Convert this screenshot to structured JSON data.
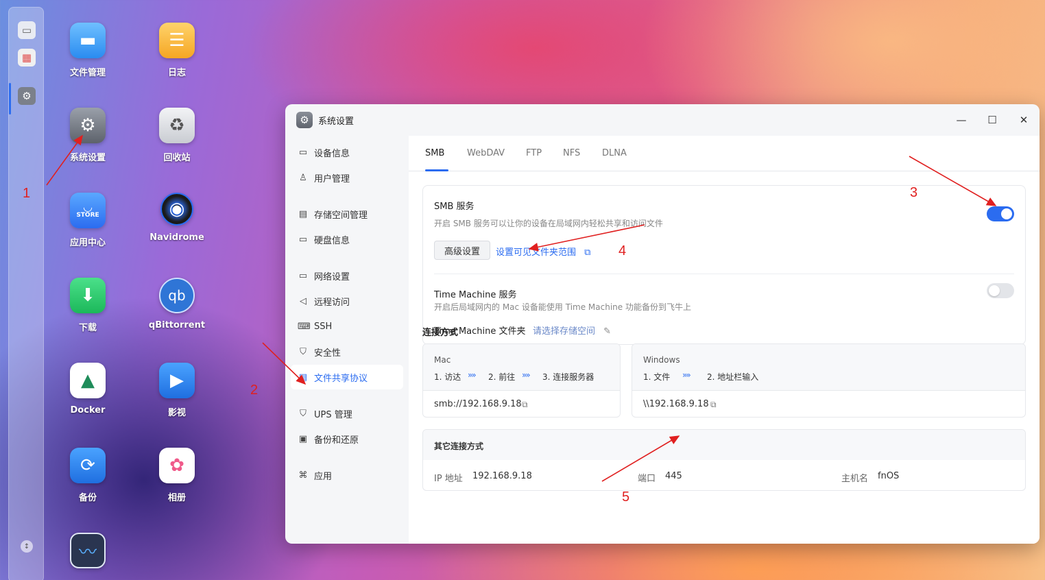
{
  "desktop": {
    "apps": [
      {
        "label": "文件管理",
        "icon": "folder-icon"
      },
      {
        "label": "日志",
        "icon": "log-icon"
      },
      {
        "label": "系统设置",
        "icon": "gear-icon"
      },
      {
        "label": "回收站",
        "icon": "recycle-icon"
      },
      {
        "label": "应用中心",
        "icon": "store-icon",
        "badge": "STORE"
      },
      {
        "label": "Navidrome",
        "icon": "vinyl-icon"
      },
      {
        "label": "下载",
        "icon": "download-icon"
      },
      {
        "label": "qBittorrent",
        "icon": "qb-icon",
        "badge": "qb"
      },
      {
        "label": "Docker",
        "icon": "docker-icon"
      },
      {
        "label": "影视",
        "icon": "video-icon"
      },
      {
        "label": "备份",
        "icon": "backup-icon"
      },
      {
        "label": "相册",
        "icon": "photos-icon"
      },
      {
        "label": "",
        "icon": "monitor-icon"
      }
    ]
  },
  "annotations": [
    "1",
    "2",
    "3",
    "4",
    "5"
  ],
  "window": {
    "title": "系统设置",
    "controls": {
      "minimize": "—",
      "maximize": "☐",
      "close": "✕"
    }
  },
  "sidebar": {
    "items": [
      {
        "label": "设备信息",
        "icon": "device-icon"
      },
      {
        "label": "用户管理",
        "icon": "user-icon"
      },
      {
        "label": "存储空间管理",
        "icon": "storage-icon"
      },
      {
        "label": "硬盘信息",
        "icon": "disk-icon"
      },
      {
        "label": "网络设置",
        "icon": "network-icon"
      },
      {
        "label": "远程访问",
        "icon": "remote-icon"
      },
      {
        "label": "SSH",
        "icon": "ssh-icon"
      },
      {
        "label": "安全性",
        "icon": "shield-icon"
      },
      {
        "label": "文件共享协议",
        "icon": "file-share-icon",
        "active": true
      },
      {
        "label": "UPS 管理",
        "icon": "ups-icon"
      },
      {
        "label": "备份和还原",
        "icon": "backup-restore-icon"
      },
      {
        "label": "应用",
        "icon": "apps-icon"
      }
    ]
  },
  "tabs": [
    {
      "label": "SMB",
      "active": true
    },
    {
      "label": "WebDAV"
    },
    {
      "label": "FTP"
    },
    {
      "label": "NFS"
    },
    {
      "label": "DLNA"
    }
  ],
  "smb": {
    "title": "SMB 服务",
    "desc": "开启 SMB 服务可以让你的设备在局域网内轻松共享和访问文件",
    "enabled": true,
    "advanced_btn": "高级设置",
    "visible_range_link": "设置可见文件夹范围",
    "tm_title": "Time Machine 服务",
    "tm_desc": "开启后局域网内的 Mac 设备能使用 Time Machine 功能备份到飞牛上",
    "tm_enabled": false,
    "tm_folder_label": "Time Machine 文件夹",
    "tm_folder_value": "请选择存储空间"
  },
  "connection": {
    "title": "连接方式",
    "mac": {
      "os": "Mac",
      "steps": [
        "1. 访达",
        "2. 前往",
        "3. 连接服务器"
      ],
      "address": "smb://192.168.9.18"
    },
    "windows": {
      "os": "Windows",
      "steps": [
        "1. 文件",
        "2. 地址栏输入"
      ],
      "address": "\\\\192.168.9.18"
    },
    "chevron": "»»",
    "other": {
      "title": "其它连接方式",
      "ip_label": "IP 地址",
      "ip_value": "192.168.9.18",
      "port_label": "端口",
      "port_value": "445",
      "host_label": "主机名",
      "host_value": "fnOS"
    }
  },
  "colors": {
    "accent": "#2b6cf0",
    "annotation": "#e02020"
  }
}
